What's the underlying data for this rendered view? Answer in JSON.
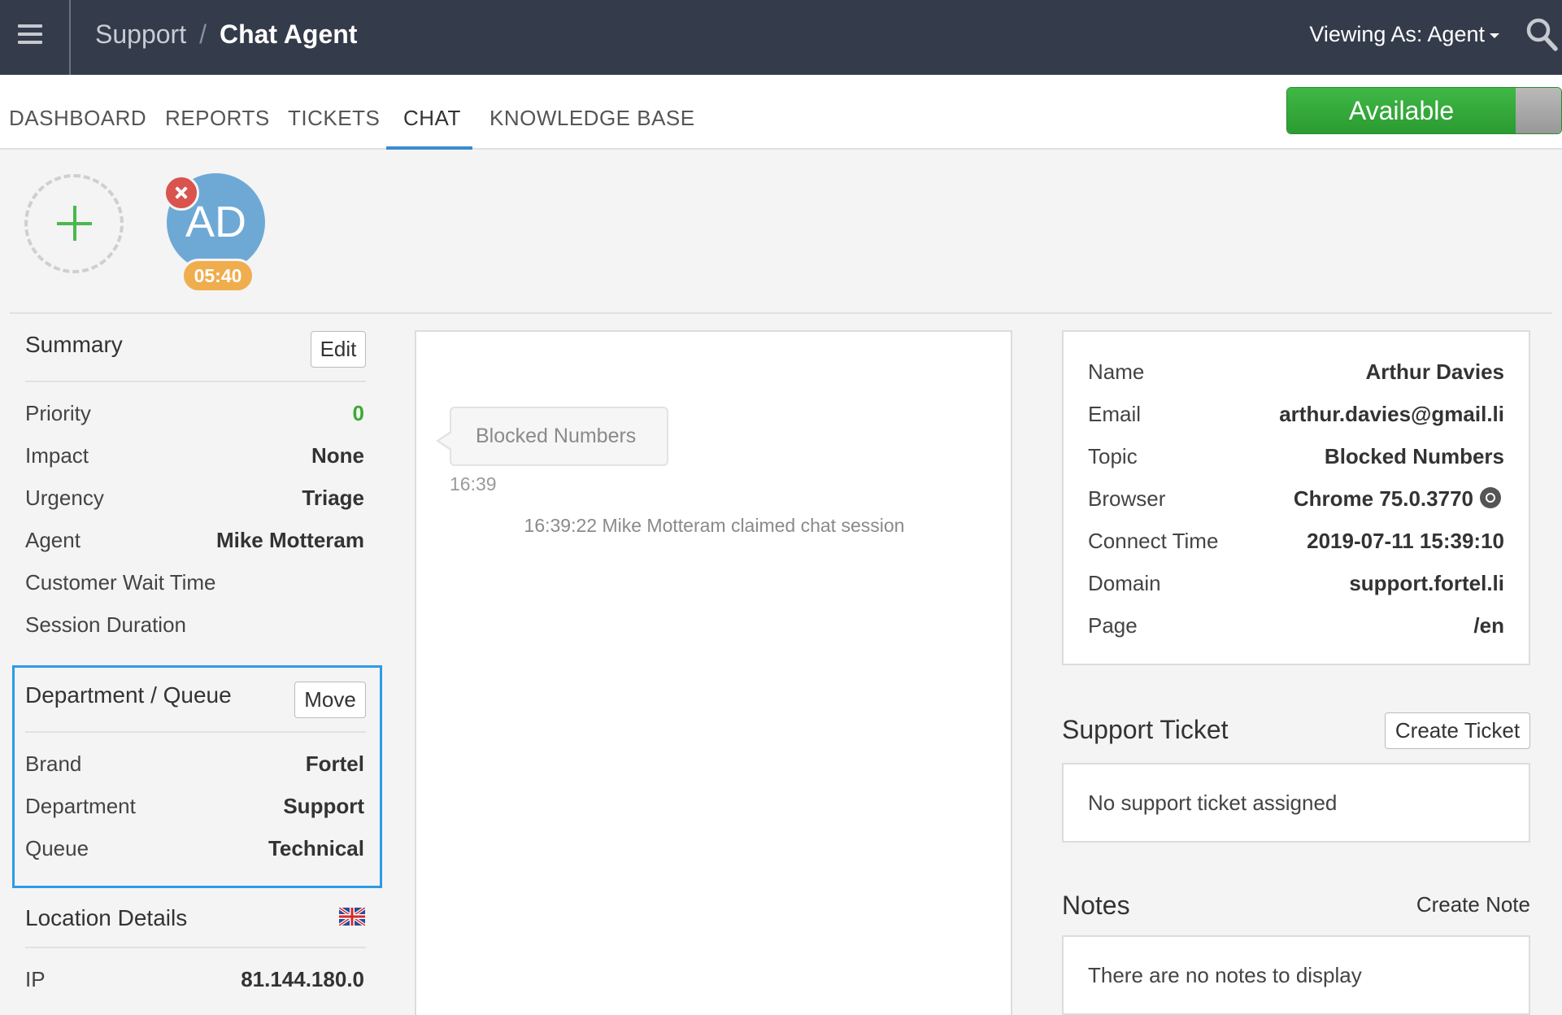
{
  "header": {
    "breadcrumb_root": "Support",
    "breadcrumb_separator": "/",
    "breadcrumb_current": "Chat Agent",
    "viewing_as": "Viewing As: Agent"
  },
  "nav": {
    "tabs": [
      {
        "label": "DASHBOARD"
      },
      {
        "label": "REPORTS"
      },
      {
        "label": "TICKETS"
      },
      {
        "label": "CHAT",
        "active": true
      },
      {
        "label": "KNOWLEDGE BASE"
      }
    ],
    "status": "Available"
  },
  "sessions": {
    "avatar_initials": "AD",
    "timer": "05:40"
  },
  "summary": {
    "title": "Summary",
    "edit_label": "Edit",
    "rows": [
      {
        "label": "Priority",
        "value": "0"
      },
      {
        "label": "Impact",
        "value": "None"
      },
      {
        "label": "Urgency",
        "value": "Triage"
      },
      {
        "label": "Agent",
        "value": "Mike Motteram"
      },
      {
        "label": "Customer Wait Time",
        "value": ""
      },
      {
        "label": "Session Duration",
        "value": ""
      }
    ]
  },
  "department": {
    "title": "Department / Queue",
    "move_label": "Move",
    "rows": [
      {
        "label": "Brand",
        "value": "Fortel"
      },
      {
        "label": "Department",
        "value": "Support"
      },
      {
        "label": "Queue",
        "value": "Technical"
      }
    ]
  },
  "location": {
    "title": "Location Details",
    "rows": [
      {
        "label": "IP",
        "value": "81.144.180.0"
      }
    ]
  },
  "chat": {
    "message": "Blocked Numbers",
    "message_time": "16:39",
    "event": "16:39:22 Mike Motteram claimed chat session"
  },
  "customer": {
    "rows": [
      {
        "label": "Name",
        "value": "Arthur Davies"
      },
      {
        "label": "Email",
        "value": "arthur.davies@gmail.li"
      },
      {
        "label": "Topic",
        "value": "Blocked Numbers"
      },
      {
        "label": "Browser",
        "value": "Chrome 75.0.3770"
      },
      {
        "label": "Connect Time",
        "value": "2019-07-11 15:39:10"
      },
      {
        "label": "Domain",
        "value": "support.fortel.li"
      },
      {
        "label": "Page",
        "value": "/en"
      }
    ]
  },
  "support_ticket": {
    "title": "Support Ticket",
    "create_label": "Create Ticket",
    "empty_text": "No support ticket assigned"
  },
  "notes": {
    "title": "Notes",
    "create_label": "Create Note",
    "empty_text": "There are no notes to display"
  }
}
